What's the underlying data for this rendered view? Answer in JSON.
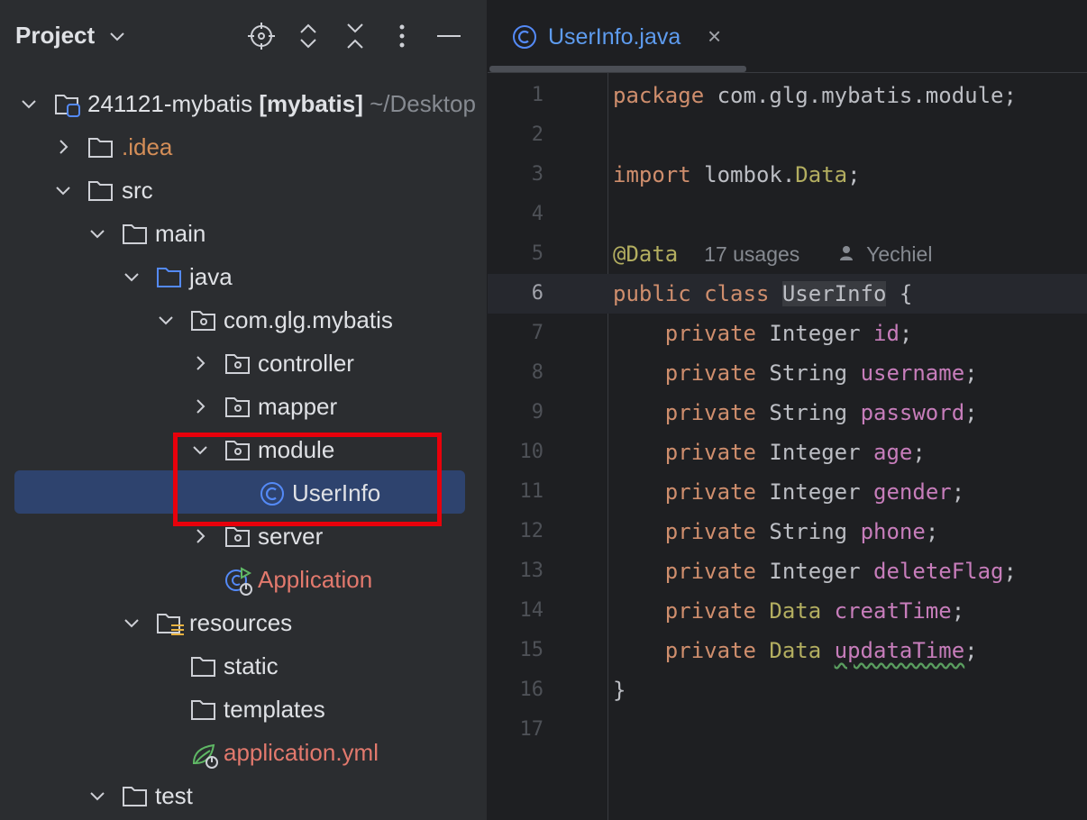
{
  "sidebar": {
    "title": "Project",
    "tools": [
      {
        "name": "locate-icon"
      },
      {
        "name": "expand-all-icon"
      },
      {
        "name": "collapse-all-icon"
      },
      {
        "name": "more-options-icon"
      },
      {
        "name": "minimize-icon"
      }
    ],
    "tree": [
      {
        "label": "241121-mybatis",
        "bold_part": "[mybatis]",
        "path": "~/Desktop"
      },
      {
        "label": ".idea"
      },
      {
        "label": "src"
      },
      {
        "label": "main"
      },
      {
        "label": "java"
      },
      {
        "label": "com.glg.mybatis"
      },
      {
        "label": "controller"
      },
      {
        "label": "mapper"
      },
      {
        "label": "module"
      },
      {
        "label": "UserInfo"
      },
      {
        "label": "server"
      },
      {
        "label": "Application"
      },
      {
        "label": "resources"
      },
      {
        "label": "static"
      },
      {
        "label": "templates"
      },
      {
        "label": "application.yml"
      },
      {
        "label": "test"
      }
    ]
  },
  "editor": {
    "tab": {
      "label": "UserInfo.java",
      "close_glyph": "×"
    },
    "line_numbers": [
      "1",
      "2",
      "3",
      "4",
      "5",
      "6",
      "7",
      "8",
      "9",
      "10",
      "11",
      "12",
      "13",
      "14",
      "15",
      "16",
      "17"
    ],
    "code": {
      "l1_kw": "package",
      "l1_rest": " com.glg.mybatis.module;",
      "l3_kw": "import",
      "l3_mid": " lombok.",
      "l3_cls": "Data",
      "l3_end": ";",
      "l5_ann": "@Data",
      "l5_usages": "17 usages",
      "l5_author": "Yechiel",
      "l6_kw": "public class",
      "l6_cls": "UserInfo",
      "l6_end": " {",
      "private_kw": "private",
      "fields": [
        {
          "type": "Integer",
          "name": "id"
        },
        {
          "type": "String",
          "name": "username"
        },
        {
          "type": "String",
          "name": "password"
        },
        {
          "type": "Integer",
          "name": "age"
        },
        {
          "type": "Integer",
          "name": "gender"
        },
        {
          "type": "String",
          "name": "phone"
        },
        {
          "type": "Integer",
          "name": "deleteFlag"
        },
        {
          "type": "Data",
          "name": "creatTime"
        },
        {
          "type": "Data",
          "name": "updataTime"
        }
      ],
      "semicolon": ";",
      "l16": "}"
    }
  },
  "colors": {
    "sidebar_bg": "#2b2d30",
    "editor_bg": "#1e1f22",
    "selection": "#2e436e",
    "highlight_box": "#e8000b",
    "keyword": "#cf8e6d",
    "field": "#c77dbb",
    "annotation": "#b3ae60"
  }
}
